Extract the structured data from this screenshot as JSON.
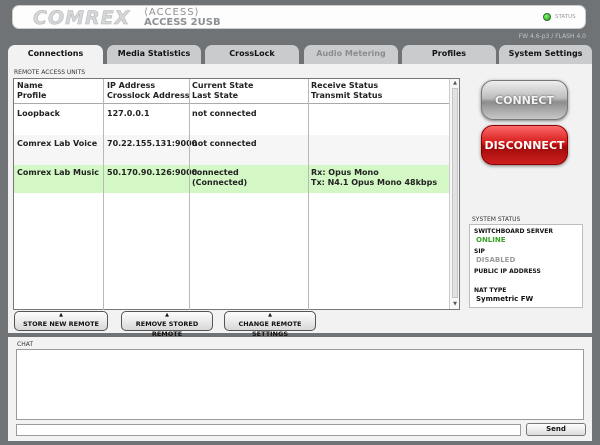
{
  "header": {
    "logo_text": "COMREX",
    "product_line": "ACCESS",
    "product_model": "ACCESS 2USB",
    "status_label": "STATUS",
    "firmware": "FW 4.6-p3 / FLASH 4.0"
  },
  "tabs": [
    {
      "label": "Connections",
      "state": "active"
    },
    {
      "label": "Media Statistics",
      "state": "normal"
    },
    {
      "label": "CrossLock",
      "state": "normal"
    },
    {
      "label": "Audio Metering",
      "state": "disabled"
    },
    {
      "label": "Profiles",
      "state": "normal"
    },
    {
      "label": "System Settings",
      "state": "normal"
    }
  ],
  "remotes": {
    "section_label": "REMOTE ACCESS UNITS",
    "headers": {
      "col1_line1": "Name",
      "col1_line2": "Profile",
      "col2_line1": "IP Address",
      "col2_line2": "Crosslock Address",
      "col3_line1": "Current State",
      "col3_line2": "Last State",
      "col4_line1": "Receive Status",
      "col4_line2": "Transmit Status"
    },
    "rows": [
      {
        "name": "Loopback",
        "ip": "127.0.0.1",
        "state_line1": "not connected",
        "state_line2": "",
        "status_line1": "",
        "status_line2": ""
      },
      {
        "name": "Comrex Lab Voice",
        "ip": "70.22.155.131:9000",
        "state_line1": "not connected",
        "state_line2": "",
        "status_line1": "",
        "status_line2": ""
      },
      {
        "name": "Comrex Lab Music",
        "ip": "50.170.90.126:9000",
        "state_line1": "connected",
        "state_line2": "(Connected)",
        "status_line1": "Rx: Opus Mono",
        "status_line2": "Tx: N4.1 Opus Mono 48kbps"
      }
    ],
    "buttons": {
      "store": "STORE NEW REMOTE",
      "remove": "REMOVE STORED REMOTE",
      "change": "CHANGE REMOTE SETTINGS"
    }
  },
  "controls": {
    "connect": "CONNECT",
    "disconnect": "DISCONNECT"
  },
  "system_status": {
    "label": "SYSTEM STATUS",
    "switchboard_label": "SWITCHBOARD SERVER",
    "switchboard_value": "ONLINE",
    "sip_label": "SIP",
    "sip_value": "DISABLED",
    "public_ip_label": "PUBLIC IP ADDRESS",
    "public_ip_value": "",
    "nat_label": "NAT TYPE",
    "nat_value": "Symmetric FW"
  },
  "chat": {
    "label": "CHAT",
    "input_value": "",
    "send_label": "Send"
  },
  "colors": {
    "online": "#3aa12a",
    "disabled": "#9a9a9a",
    "connected_row": "#d3f7c5",
    "disconnect_red": "#d31a1a"
  }
}
